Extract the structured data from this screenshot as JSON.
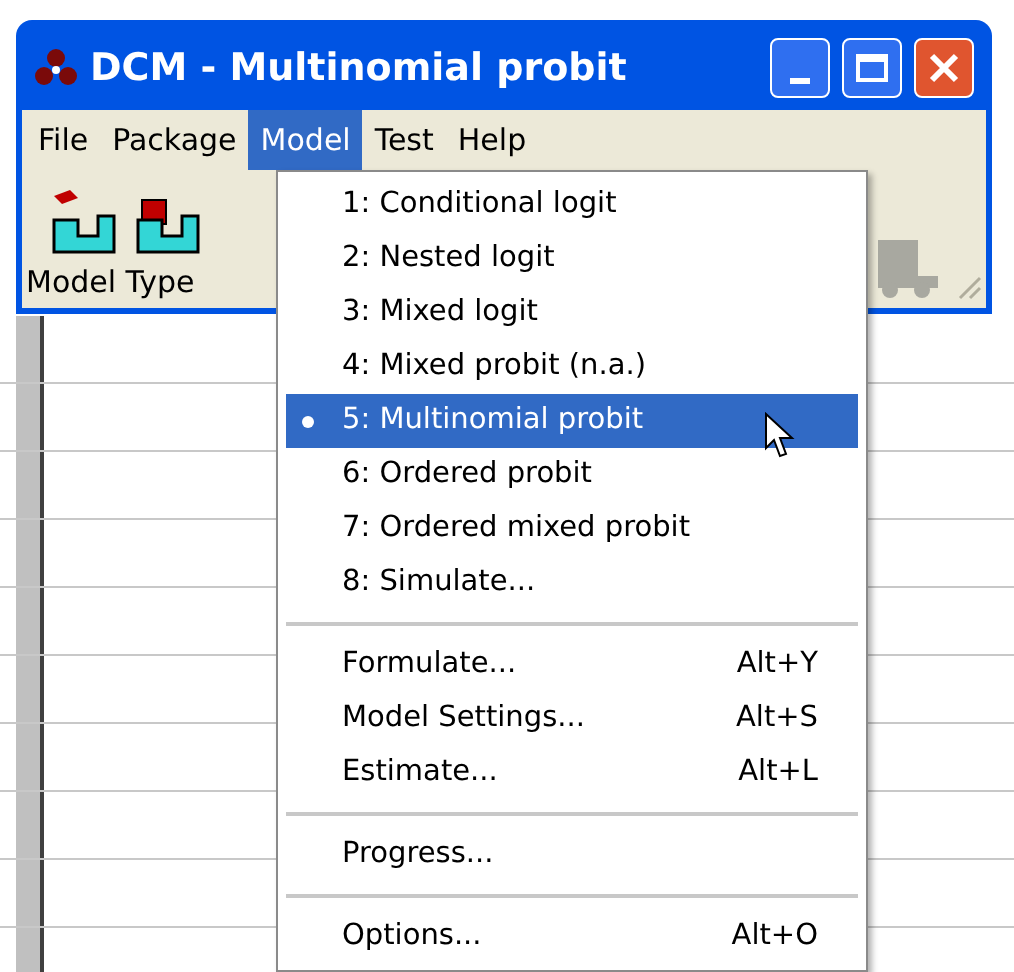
{
  "window": {
    "title": "DCM - Multinomial probit"
  },
  "menu_bar": [
    {
      "label": "File",
      "selected": false
    },
    {
      "label": "Package",
      "selected": false
    },
    {
      "label": "Model",
      "selected": true
    },
    {
      "label": "Test",
      "selected": false
    },
    {
      "label": "Help",
      "selected": false
    }
  ],
  "toolbar": {
    "label": "Model Type"
  },
  "model_menu": {
    "groups": [
      [
        {
          "label": "1: Conditional logit",
          "checked": false,
          "selected": false
        },
        {
          "label": "2: Nested logit",
          "checked": false,
          "selected": false
        },
        {
          "label": "3: Mixed logit",
          "checked": false,
          "selected": false
        },
        {
          "label": "4: Mixed probit (n.a.)",
          "checked": false,
          "selected": false
        },
        {
          "label": "5: Multinomial probit",
          "checked": true,
          "selected": true
        },
        {
          "label": "6: Ordered probit",
          "checked": false,
          "selected": false
        },
        {
          "label": "7: Ordered mixed probit",
          "checked": false,
          "selected": false
        },
        {
          "label": "8: Simulate...",
          "checked": false,
          "selected": false
        }
      ],
      [
        {
          "label": "Formulate...",
          "shortcut": "Alt+Y",
          "selected": false
        },
        {
          "label": "Model Settings...",
          "shortcut": "Alt+S",
          "selected": false
        },
        {
          "label": "Estimate...",
          "shortcut": "Alt+L",
          "selected": false
        }
      ],
      [
        {
          "label": "Progress...",
          "selected": false
        }
      ],
      [
        {
          "label": "Options...",
          "shortcut": "Alt+O",
          "selected": false
        }
      ]
    ]
  }
}
